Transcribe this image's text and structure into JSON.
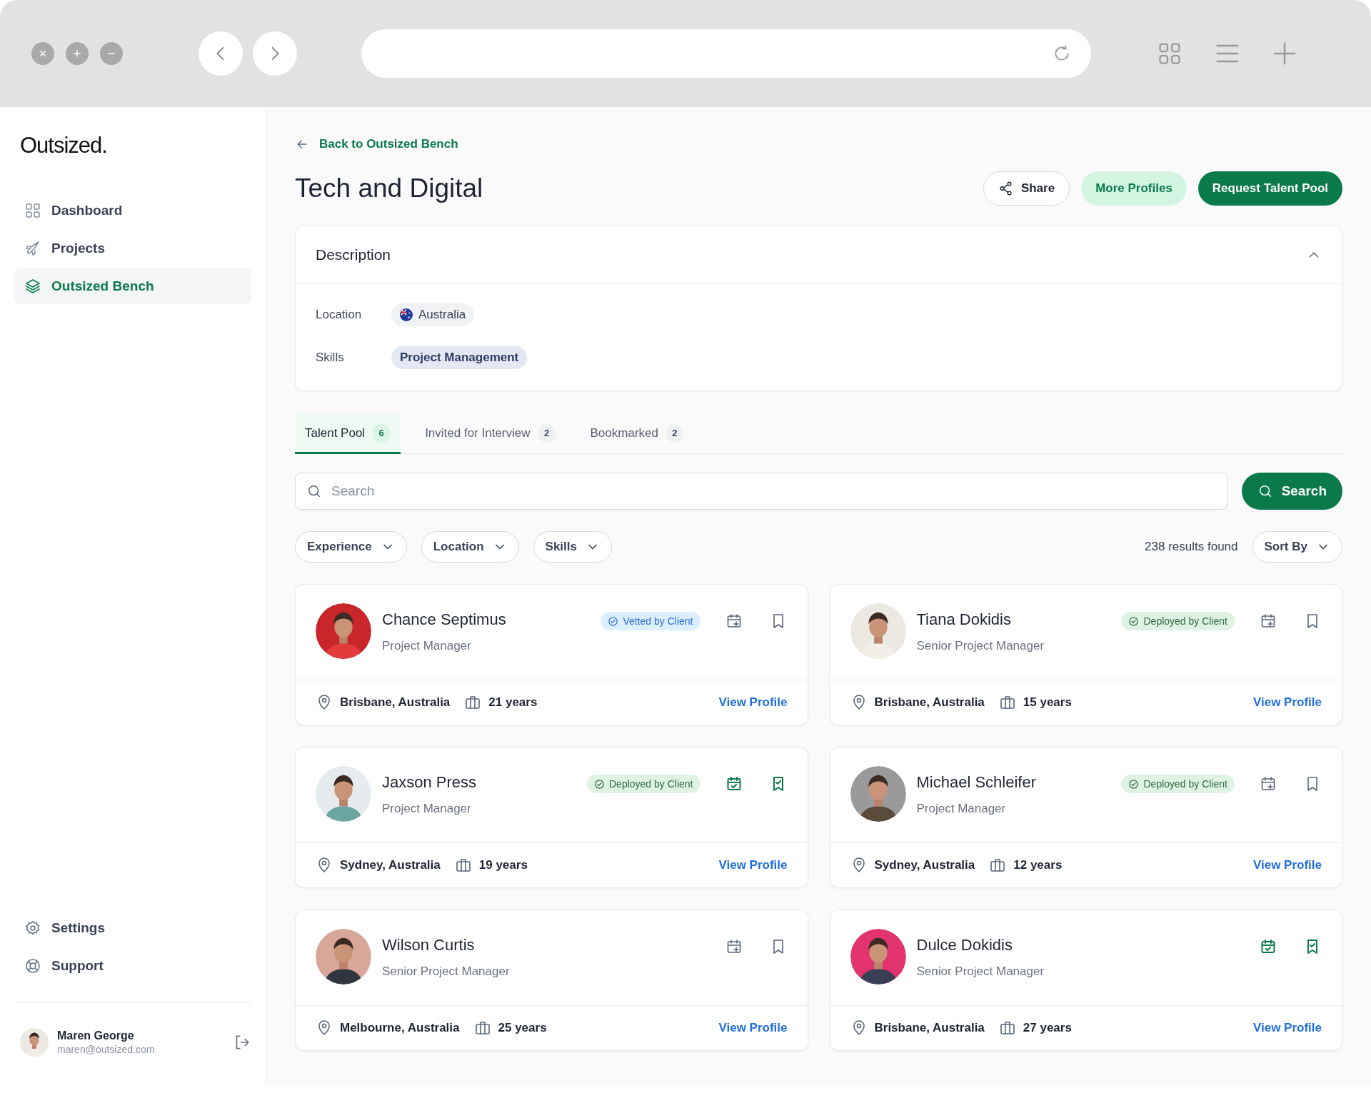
{
  "sidebar": {
    "logo": "Outsized.",
    "nav": [
      {
        "label": "Dashboard",
        "selected": false
      },
      {
        "label": "Projects",
        "selected": false
      },
      {
        "label": "Outsized Bench",
        "selected": true
      }
    ],
    "footer_nav": [
      {
        "label": "Settings"
      },
      {
        "label": "Support"
      }
    ],
    "user": {
      "name": "Maren George",
      "email": "maren@outsized.com"
    }
  },
  "header": {
    "back_link": "Back to Outsized Bench",
    "title": "Tech and Digital",
    "actions": [
      {
        "label": "Share",
        "kind": "outline"
      },
      {
        "label": "More Profiles",
        "kind": "soft"
      },
      {
        "label": "Request Talent Pool",
        "kind": "primary"
      }
    ]
  },
  "description": {
    "title": "Description",
    "expanded": true,
    "location_label": "Location",
    "location": "Australia",
    "skills_label": "Skills",
    "skills": [
      "Project Management"
    ]
  },
  "tabs": [
    {
      "label": "Talent Pool",
      "count": "6",
      "selected": true
    },
    {
      "label": "Invited for Interview",
      "count": "2",
      "selected": false
    },
    {
      "label": "Bookmarked",
      "count": "2",
      "selected": false
    }
  ],
  "search": {
    "placeholder": "Search",
    "button": "Search"
  },
  "filters": [
    "Experience",
    "Location",
    "Skills"
  ],
  "results": "238 results found",
  "sort": "Sort By",
  "candidates": [
    {
      "name": "Chance Septimus",
      "title": "Project Manager",
      "badge": {
        "kind": "vetted",
        "label": "Vetted by Client"
      },
      "scheduled": false,
      "bookmarked": false,
      "location": "Brisbane, Australia",
      "experience": "21 years",
      "link": "View Profile"
    },
    {
      "name": "Tiana Dokidis",
      "title": "Senior Project Manager",
      "badge": {
        "kind": "deployed",
        "label": "Deployed by Client"
      },
      "scheduled": false,
      "bookmarked": false,
      "location": "Brisbane, Australia",
      "experience": "15 years",
      "link": "View Profile"
    },
    {
      "name": "Jaxson Press",
      "title": "Project Manager",
      "badge": {
        "kind": "deployed",
        "label": "Deployed by Client"
      },
      "scheduled": true,
      "bookmarked": true,
      "location": "Sydney, Australia",
      "experience": "19 years",
      "link": "View Profile"
    },
    {
      "name": "Michael Schleifer",
      "title": "Project Manager",
      "badge": {
        "kind": "deployed",
        "label": "Deployed by Client"
      },
      "scheduled": false,
      "bookmarked": false,
      "location": "Sydney, Australia",
      "experience": "12 years",
      "link": "View Profile"
    },
    {
      "name": "Wilson Curtis",
      "title": "Senior Project Manager",
      "scheduled": false,
      "bookmarked": false,
      "location": "Melbourne, Australia",
      "experience": "25 years",
      "link": "View Profile"
    },
    {
      "name": "Dulce Dokidis",
      "title": "Senior Project Manager",
      "scheduled": true,
      "bookmarked": true,
      "location": "Brisbane, Australia",
      "experience": "27 years",
      "link": "View Profile"
    }
  ]
}
